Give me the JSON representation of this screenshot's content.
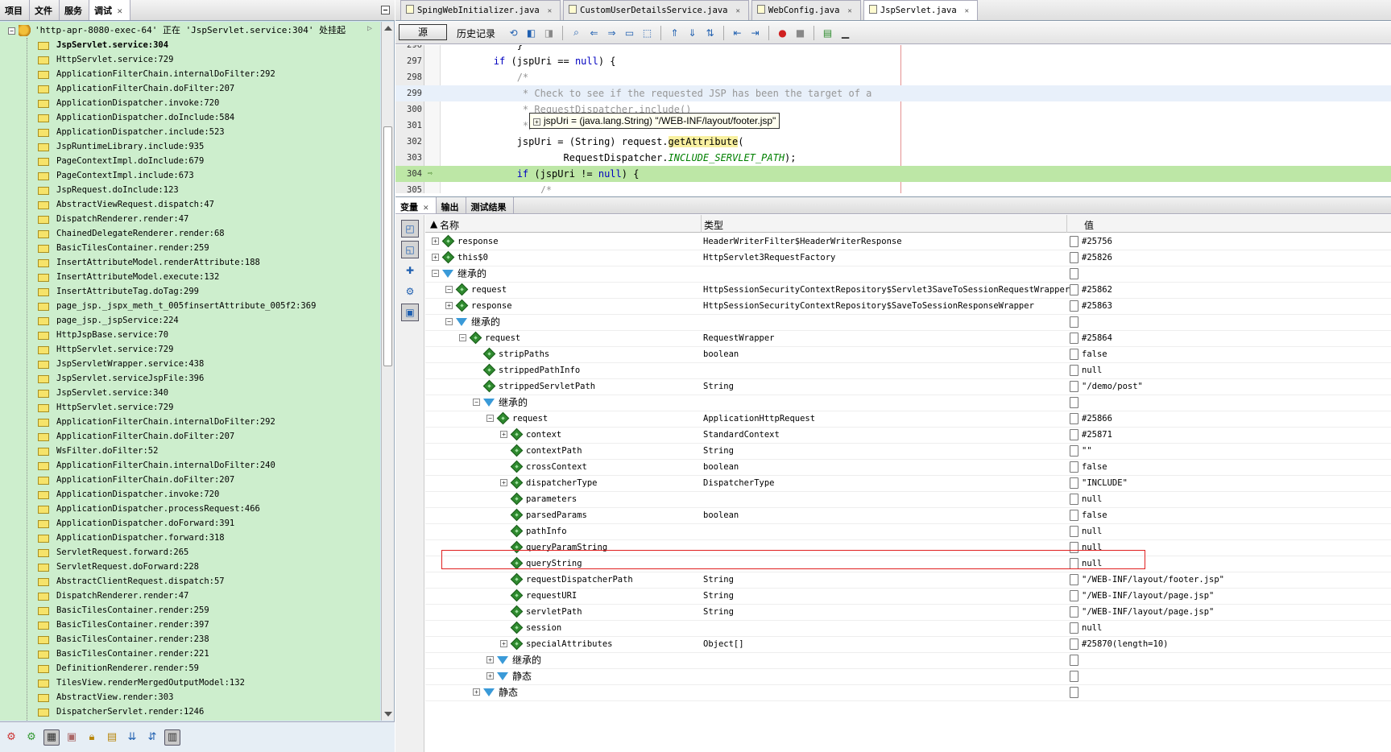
{
  "left_panel": {
    "tabs": [
      {
        "label": "项目",
        "active": false
      },
      {
        "label": "文件",
        "active": false
      },
      {
        "label": "服务",
        "active": false
      },
      {
        "label": "调试",
        "active": true
      }
    ],
    "thread_label": "'http-apr-8080-exec-64' 正在 'JspServlet.service:304' 处挂起",
    "frames": [
      "JspServlet.service:304",
      "HttpServlet.service:729",
      "ApplicationFilterChain.internalDoFilter:292",
      "ApplicationFilterChain.doFilter:207",
      "ApplicationDispatcher.invoke:720",
      "ApplicationDispatcher.doInclude:584",
      "ApplicationDispatcher.include:523",
      "JspRuntimeLibrary.include:935",
      "PageContextImpl.doInclude:679",
      "PageContextImpl.include:673",
      "JspRequest.doInclude:123",
      "AbstractViewRequest.dispatch:47",
      "DispatchRenderer.render:47",
      "ChainedDelegateRenderer.render:68",
      "BasicTilesContainer.render:259",
      "InsertAttributeModel.renderAttribute:188",
      "InsertAttributeModel.execute:132",
      "InsertAttributeTag.doTag:299",
      "page_jsp._jspx_meth_t_005finsertAttribute_005f2:369",
      "page_jsp._jspService:224",
      "HttpJspBase.service:70",
      "HttpServlet.service:729",
      "JspServletWrapper.service:438",
      "JspServlet.serviceJspFile:396",
      "JspServlet.service:340",
      "HttpServlet.service:729",
      "ApplicationFilterChain.internalDoFilter:292",
      "ApplicationFilterChain.doFilter:207",
      "WsFilter.doFilter:52",
      "ApplicationFilterChain.internalDoFilter:240",
      "ApplicationFilterChain.doFilter:207",
      "ApplicationDispatcher.invoke:720",
      "ApplicationDispatcher.processRequest:466",
      "ApplicationDispatcher.doForward:391",
      "ApplicationDispatcher.forward:318",
      "ServletRequest.forward:265",
      "ServletRequest.doForward:228",
      "AbstractClientRequest.dispatch:57",
      "DispatchRenderer.render:47",
      "BasicTilesContainer.render:259",
      "BasicTilesContainer.render:397",
      "BasicTilesContainer.render:238",
      "BasicTilesContainer.render:221",
      "DefinitionRenderer.render:59",
      "TilesView.renderMergedOutputModel:132",
      "AbstractView.render:303",
      "DispatcherServlet.render:1246"
    ]
  },
  "editor": {
    "tabs": [
      {
        "label": "SpingWebInitializer.java",
        "active": false
      },
      {
        "label": "CustomUserDetailsService.java",
        "active": false
      },
      {
        "label": "WebConfig.java",
        "active": false
      },
      {
        "label": "JspServlet.java",
        "active": true
      }
    ],
    "source_button": "源",
    "history_button": "历史记录",
    "lines": [
      {
        "num": "296",
        "text": "            }"
      },
      {
        "num": "297",
        "text": "        if (jspUri == null) {"
      },
      {
        "num": "298",
        "text": "            /*"
      },
      {
        "num": "299",
        "text": "             * Check to see if the requested JSP has been the target of a"
      },
      {
        "num": "300",
        "text": "             * RequestDispatcher.include()"
      },
      {
        "num": "301",
        "text": "             */"
      },
      {
        "num": "302",
        "text": "            jspUri = (String) request.getAttribute("
      },
      {
        "num": "303",
        "text": "                    RequestDispatcher.INCLUDE_SERVLET_PATH);"
      },
      {
        "num": "304",
        "text": "            if (jspUri != null) {"
      },
      {
        "num": "305",
        "text": "                /*"
      }
    ],
    "tooltip": "jspUri = (java.lang.String) \"/WEB-INF/layout/footer.jsp\""
  },
  "bottom_panel": {
    "tabs": [
      {
        "label": "变量",
        "active": true
      },
      {
        "label": "输出",
        "active": false
      },
      {
        "label": "测试结果",
        "active": false
      }
    ],
    "columns": {
      "name": "名称",
      "type": "类型",
      "value": "值"
    },
    "rows": [
      {
        "name": "response",
        "type": "HeaderWriterFilter$HeaderWriterResponse",
        "value": "#25756",
        "kind": "field",
        "expander": "+"
      },
      {
        "name": "this$0",
        "type": "HttpServlet3RequestFactory",
        "value": "#25826",
        "kind": "field",
        "expander": "+"
      },
      {
        "name": "继承的",
        "type": "",
        "value": "",
        "kind": "inherited",
        "expander": "-"
      },
      {
        "name": "request",
        "type": "HttpSessionSecurityContextRepository$Servlet3SaveToSessionRequestWrapper",
        "value": "#25862",
        "kind": "field",
        "expander": "-"
      },
      {
        "name": "response",
        "type": "HttpSessionSecurityContextRepository$SaveToSessionResponseWrapper",
        "value": "#25863",
        "kind": "field",
        "expander": "+"
      },
      {
        "name": "继承的",
        "type": "",
        "value": "",
        "kind": "inherited",
        "expander": "-"
      },
      {
        "name": "request",
        "type": "RequestWrapper",
        "value": "#25864",
        "kind": "field",
        "expander": "-"
      },
      {
        "name": "stripPaths",
        "type": "boolean",
        "value": "false",
        "kind": "field",
        "expander": ""
      },
      {
        "name": "strippedPathInfo",
        "type": "",
        "value": "null",
        "kind": "field",
        "expander": ""
      },
      {
        "name": "strippedServletPath",
        "type": "String",
        "value": "\"/demo/post\"",
        "kind": "field",
        "expander": ""
      },
      {
        "name": "继承的",
        "type": "",
        "value": "",
        "kind": "inherited",
        "expander": "-"
      },
      {
        "name": "request",
        "type": "ApplicationHttpRequest",
        "value": "#25866",
        "kind": "field",
        "expander": "-"
      },
      {
        "name": "context",
        "type": "StandardContext",
        "value": "#25871",
        "kind": "field",
        "expander": "+"
      },
      {
        "name": "contextPath",
        "type": "String",
        "value": "\"\"",
        "kind": "field",
        "expander": ""
      },
      {
        "name": "crossContext",
        "type": "boolean",
        "value": "false",
        "kind": "field",
        "expander": ""
      },
      {
        "name": "dispatcherType",
        "type": "DispatcherType",
        "value": "\"INCLUDE\"",
        "kind": "field",
        "expander": "+"
      },
      {
        "name": "parameters",
        "type": "",
        "value": "null",
        "kind": "field",
        "expander": ""
      },
      {
        "name": "parsedParams",
        "type": "boolean",
        "value": "false",
        "kind": "field",
        "expander": ""
      },
      {
        "name": "pathInfo",
        "type": "",
        "value": "null",
        "kind": "field",
        "expander": ""
      },
      {
        "name": "queryParamString",
        "type": "",
        "value": "null",
        "kind": "field",
        "expander": ""
      },
      {
        "name": "queryString",
        "type": "",
        "value": "null",
        "kind": "field",
        "expander": ""
      },
      {
        "name": "requestDispatcherPath",
        "type": "String",
        "value": "\"/WEB-INF/layout/footer.jsp\"",
        "kind": "field",
        "expander": "",
        "highlighted": true
      },
      {
        "name": "requestURI",
        "type": "String",
        "value": "\"/WEB-INF/layout/page.jsp\"",
        "kind": "field",
        "expander": ""
      },
      {
        "name": "servletPath",
        "type": "String",
        "value": "\"/WEB-INF/layout/page.jsp\"",
        "kind": "field",
        "expander": ""
      },
      {
        "name": "session",
        "type": "",
        "value": "null",
        "kind": "field",
        "expander": ""
      },
      {
        "name": "specialAttributes",
        "type": "Object[]",
        "value": "#25870(length=10)",
        "kind": "field",
        "expander": "+"
      },
      {
        "name": "继承的",
        "type": "",
        "value": "",
        "kind": "inherited",
        "expander": "+"
      },
      {
        "name": "静态",
        "type": "",
        "value": "",
        "kind": "inherited",
        "expander": "+"
      },
      {
        "name": "静态",
        "type": "",
        "value": "",
        "kind": "inherited",
        "expander": "+"
      }
    ]
  }
}
